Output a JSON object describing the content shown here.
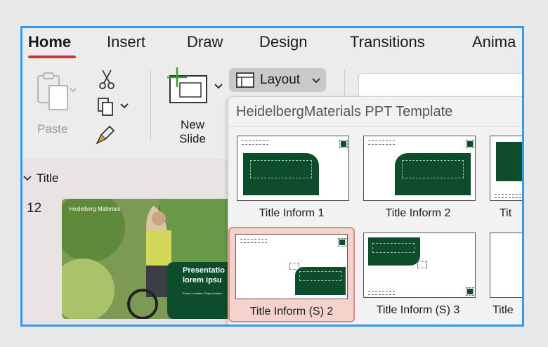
{
  "ribbon_tabs": {
    "home": "Home",
    "insert": "Insert",
    "draw": "Draw",
    "design": "Design",
    "transitions": "Transitions",
    "animations": "Anima"
  },
  "ribbon": {
    "paste_label": "Paste",
    "new_slide_label_line1": "New",
    "new_slide_label_line2": "Slide",
    "layout_label": "Layout"
  },
  "slides_panel": {
    "section_label": "Title",
    "slide_number": "12",
    "thumb_brand": "Heidelberg Materials",
    "thumb_heading_line1": "Presentatio",
    "thumb_heading_line2": "lorem ipsu",
    "thumb_meta": "Event | Location | Topic | Author"
  },
  "layout_menu": {
    "title": "HeidelbergMaterials PPT Template",
    "items": [
      {
        "label": "Title Inform 1"
      },
      {
        "label": "Title Inform 2"
      },
      {
        "label": "Tit"
      },
      {
        "label": "Title Inform (S) 2"
      },
      {
        "label": "Title Inform (S) 3"
      },
      {
        "label": "Title"
      }
    ],
    "selected_index": 3
  },
  "colors": {
    "accent": "#c63b2e",
    "brand_green": "#0e4d2c",
    "selection_fill": "#f4d3cd",
    "selection_border": "#e0897b",
    "frame_blue": "#2e9bf0"
  }
}
